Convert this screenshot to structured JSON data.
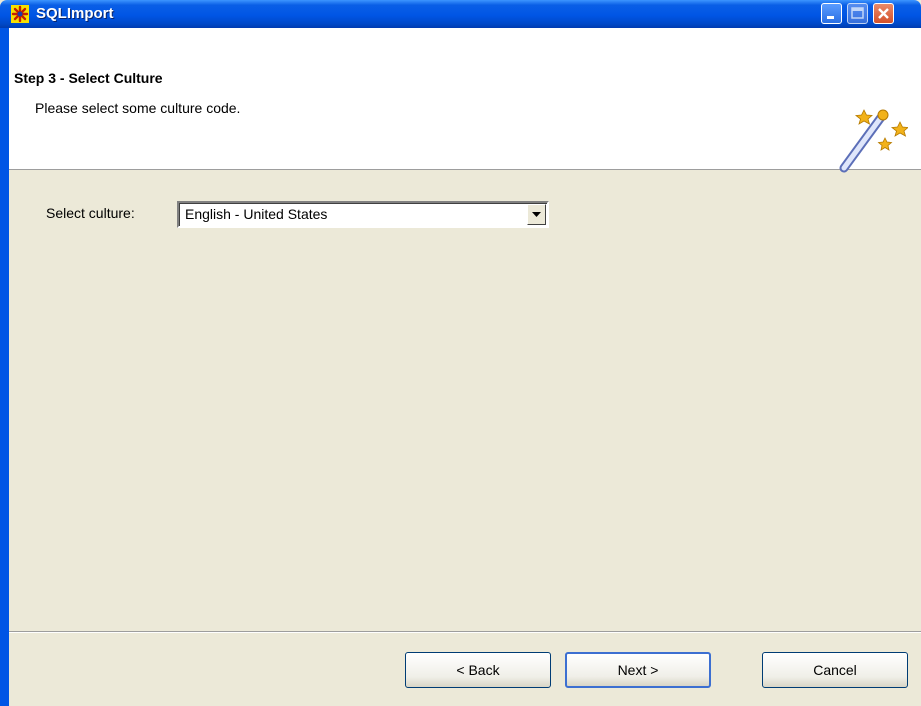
{
  "window": {
    "title": "SQLImport",
    "icons": {
      "app": "sqlimport-app-icon",
      "minimize": "minimize-icon",
      "maximize": "maximize-icon",
      "close": "close-icon"
    }
  },
  "header": {
    "step_title": "Step 3 - Select Culture",
    "step_subtitle": "Please select some culture code.",
    "icon": "magic-wand-icon"
  },
  "form": {
    "culture_label": "Select culture:",
    "culture_value": "English - United States",
    "dropdown_icon": "chevron-down-icon"
  },
  "buttons": {
    "back": "< Back",
    "next": "Next >",
    "cancel": "Cancel"
  },
  "colors": {
    "titlebar": "#0055e5",
    "dialog_bg": "#ece9d8",
    "header_bg": "#ffffff"
  }
}
